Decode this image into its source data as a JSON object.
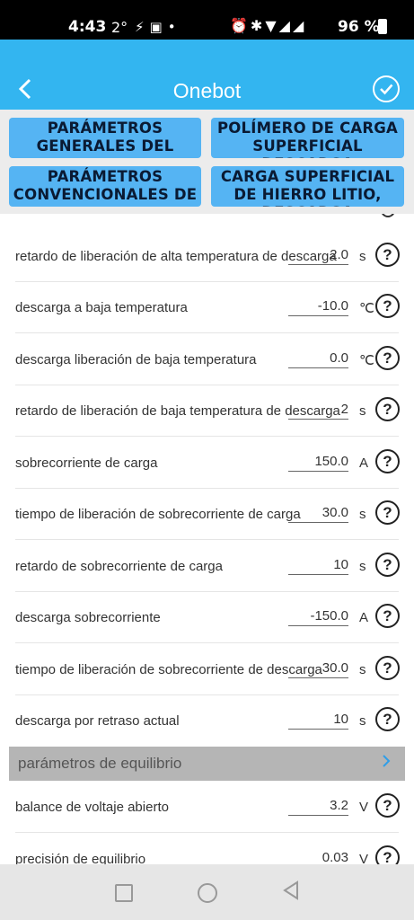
{
  "status_bar": {
    "time": "4:43",
    "temp": "2°",
    "battery": "96 %"
  },
  "app_bar": {
    "title": "Onebot"
  },
  "tabs": [
    {
      "label": "PARÁMETROS GENERALES DEL"
    },
    {
      "label": "POLÍMERO DE CARGA SUPERFICIAL DESCARGA"
    },
    {
      "label": "PARÁMETROS CONVENCIONALES DE"
    },
    {
      "label": "CARGA SUPERFICIAL DE HIERRO LITIO, DESCARGA"
    }
  ],
  "rows": [
    {
      "label": "retardo de liberación de alta temperatura de descarga",
      "value": "2.0",
      "unit": "s"
    },
    {
      "label": "descarga a baja temperatura",
      "value": "-10.0",
      "unit": "℃"
    },
    {
      "label": "descarga liberación de baja temperatura",
      "value": "0.0",
      "unit": "℃"
    },
    {
      "label": "retardo de liberación de baja temperatura de descarga",
      "value": "2",
      "unit": "s"
    },
    {
      "label": "sobrecorriente de carga",
      "value": "150.0",
      "unit": "A"
    },
    {
      "label": "tiempo de liberación de sobrecorriente de carga",
      "value": "30.0",
      "unit": "s"
    },
    {
      "label": "retardo de sobrecorriente de carga",
      "value": "10",
      "unit": "s"
    },
    {
      "label": "descarga sobrecorriente",
      "value": "-150.0",
      "unit": "A"
    },
    {
      "label": "tiempo de liberación de sobrecorriente de descarga",
      "value": "30.0",
      "unit": "s"
    },
    {
      "label": "descarga por retraso actual",
      "value": "10",
      "unit": "s"
    }
  ],
  "section": {
    "title": "parámetros de equilibrio"
  },
  "rows2": [
    {
      "label": "balance de voltaje abierto",
      "value": "3.2",
      "unit": "V"
    },
    {
      "label": "precisión de equilibrio",
      "value": "0.03",
      "unit": "V"
    }
  ],
  "help_symbol": "?",
  "icons": {
    "back": "chevron-left-icon",
    "confirm": "check-circle-icon",
    "section_arrow": "chevron-right-icon"
  },
  "colors": {
    "app_bar": "#33b5f0",
    "tab": "#55b4f3",
    "section_header": "#b5b5b5"
  }
}
